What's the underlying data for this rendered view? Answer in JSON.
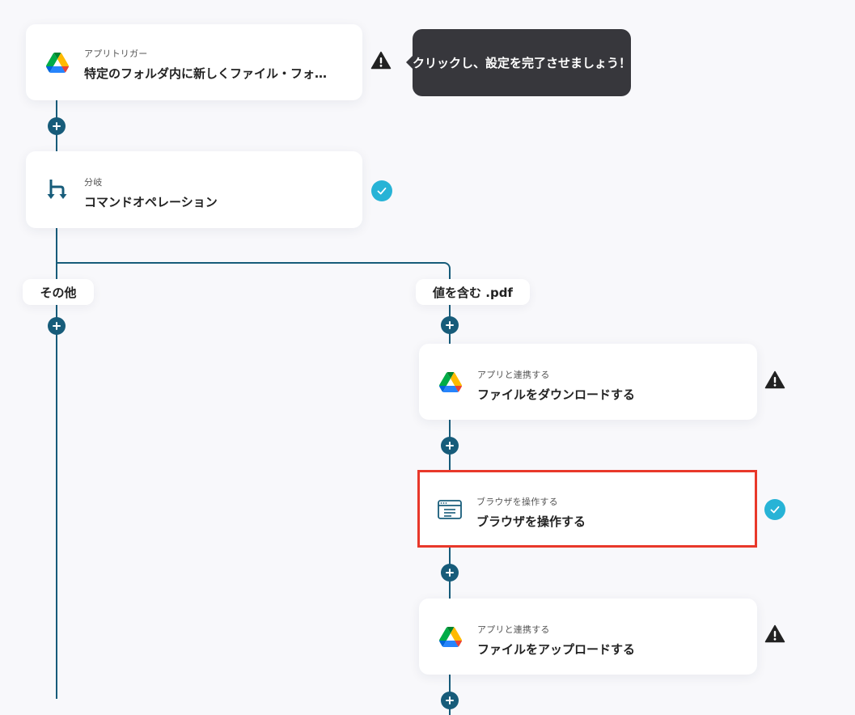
{
  "trigger": {
    "subtitle": "アプリトリガー",
    "title": "特定のフォルダ内に新しくファイル・フォ…",
    "icon": "google-drive-icon",
    "status": "warning"
  },
  "tooltip": {
    "text": "クリックし、設定を完了させましょう！"
  },
  "branch_step": {
    "subtitle": "分岐",
    "title": "コマンドオペレーション",
    "icon": "branch-icon",
    "status": "complete"
  },
  "branches": {
    "left_label": "その他",
    "right_label": "値を含む .pdf"
  },
  "steps": [
    {
      "subtitle": "アプリと連携する",
      "title": "ファイルをダウンロードする",
      "icon": "google-drive-icon",
      "status": "warning"
    },
    {
      "subtitle": "ブラウザを操作する",
      "title": "ブラウザを操作する",
      "icon": "browser-window-icon",
      "status": "complete"
    },
    {
      "subtitle": "アプリと連携する",
      "title": "ファイルをアップロードする",
      "icon": "google-drive-icon",
      "status": "warning"
    }
  ],
  "colors": {
    "connector": "#175c7a",
    "check": "#27b3d6",
    "warning": "#222222",
    "selected_border": "#e8382a",
    "tooltip_bg": "#37373c"
  }
}
